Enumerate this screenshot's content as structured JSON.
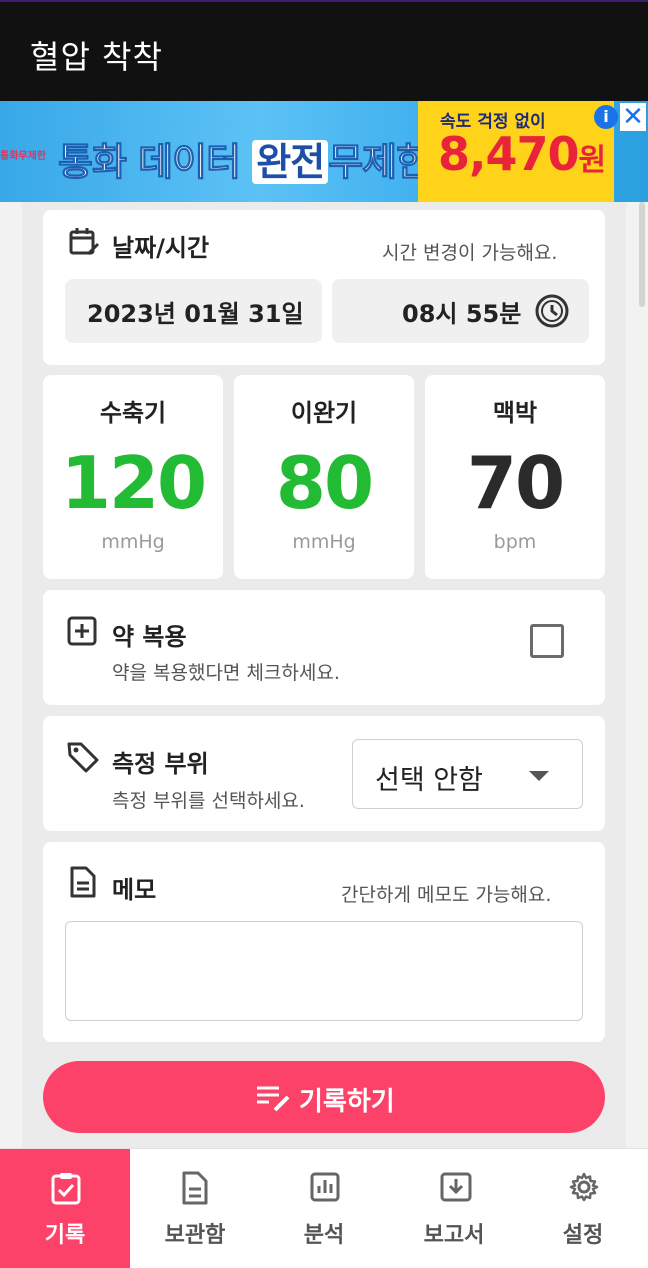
{
  "app": {
    "title": "혈압 착착"
  },
  "ad": {
    "small_text": "통화무제한",
    "headline_a": "통화 데이터 ",
    "headline_b": "완전",
    "headline_c": "무제한",
    "sub": "속도 걱정 없이",
    "price": "8,470",
    "price_unit": "원",
    "info_icon": "i",
    "close_icon": "✕"
  },
  "datetime": {
    "label": "날짜/시간",
    "hint": "시간 변경이 가능해요.",
    "date": "2023년 01월 31일",
    "time": "08시 55분"
  },
  "vitals": [
    {
      "name": "수축기",
      "value": "120",
      "unit": "mmHg",
      "color": "#22bb33"
    },
    {
      "name": "이완기",
      "value": "80",
      "unit": "mmHg",
      "color": "#22bb33"
    },
    {
      "name": "맥박",
      "value": "70",
      "unit": "bpm",
      "color": "#2b2b2b"
    }
  ],
  "medication": {
    "label": "약 복용",
    "hint": "약을 복용했다면 체크하세요.",
    "checked": false
  },
  "site": {
    "label": "측정 부위",
    "hint": "측정 부위를 선택하세요.",
    "selected": "선택 안함"
  },
  "memo": {
    "label": "메모",
    "hint": "간단하게 메모도 가능해요.",
    "value": ""
  },
  "submit": {
    "label": "기록하기"
  },
  "nav": [
    {
      "label": "기록",
      "icon": "clipboard-check-icon",
      "active": true
    },
    {
      "label": "보관함",
      "icon": "document-icon",
      "active": false
    },
    {
      "label": "분석",
      "icon": "bar-chart-icon",
      "active": false
    },
    {
      "label": "보고서",
      "icon": "download-icon",
      "active": false
    },
    {
      "label": "설정",
      "icon": "gear-icon",
      "active": false
    }
  ],
  "colors": {
    "accent": "#fd426a",
    "good": "#22bb33",
    "appbar": "#111111"
  }
}
